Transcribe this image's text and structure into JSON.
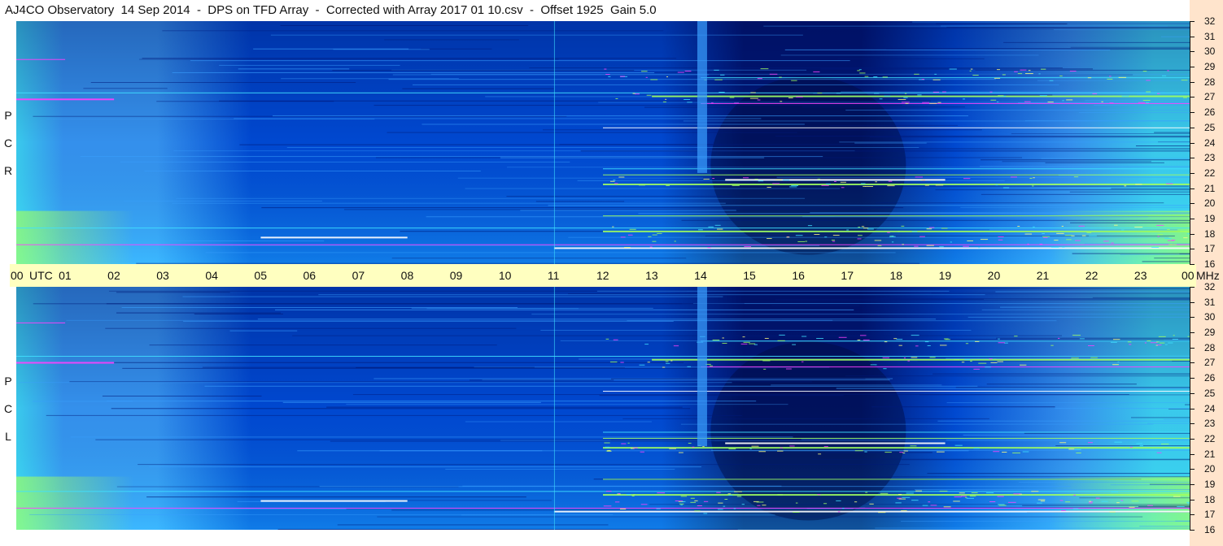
{
  "title": "AJ4CO Observatory  14 Sep 2014  -  DPS on TFD Array  -  Corrected with Array 2017 01 10.csv  -  Offset 1925  Gain 5.0",
  "chart_data": {
    "type": "heatmap",
    "title": "AJ4CO Observatory  14 Sep 2014  -  DPS on TFD Array  -  Corrected with Array 2017 01 10.csv  -  Offset 1925  Gain 5.0",
    "x_axis": {
      "unit_label": "UTC",
      "ticks": [
        "00",
        "01",
        "02",
        "03",
        "04",
        "05",
        "06",
        "07",
        "08",
        "09",
        "10",
        "11",
        "12",
        "13",
        "14",
        "15",
        "16",
        "17",
        "18",
        "19",
        "20",
        "21",
        "22",
        "23",
        "00"
      ],
      "range": [
        0,
        24
      ]
    },
    "y_axis": {
      "unit_label": "MHz",
      "ticks": [
        16,
        17,
        18,
        19,
        20,
        21,
        22,
        23,
        24,
        25,
        26,
        27,
        28,
        29,
        30,
        31,
        32
      ],
      "range": [
        16,
        32
      ]
    },
    "panels": [
      {
        "name": "RCP",
        "letters": [
          "P",
          "C",
          "R"
        ]
      },
      {
        "name": "LCP",
        "letters": [
          "P",
          "C",
          "L"
        ]
      }
    ],
    "colors": {
      "dark": "#001a7a",
      "mid": "#0050e0",
      "light": "#3aa0ff",
      "cyan": "#40e0ff",
      "green": "#a0ff60",
      "hot": "#ff40ff"
    }
  }
}
